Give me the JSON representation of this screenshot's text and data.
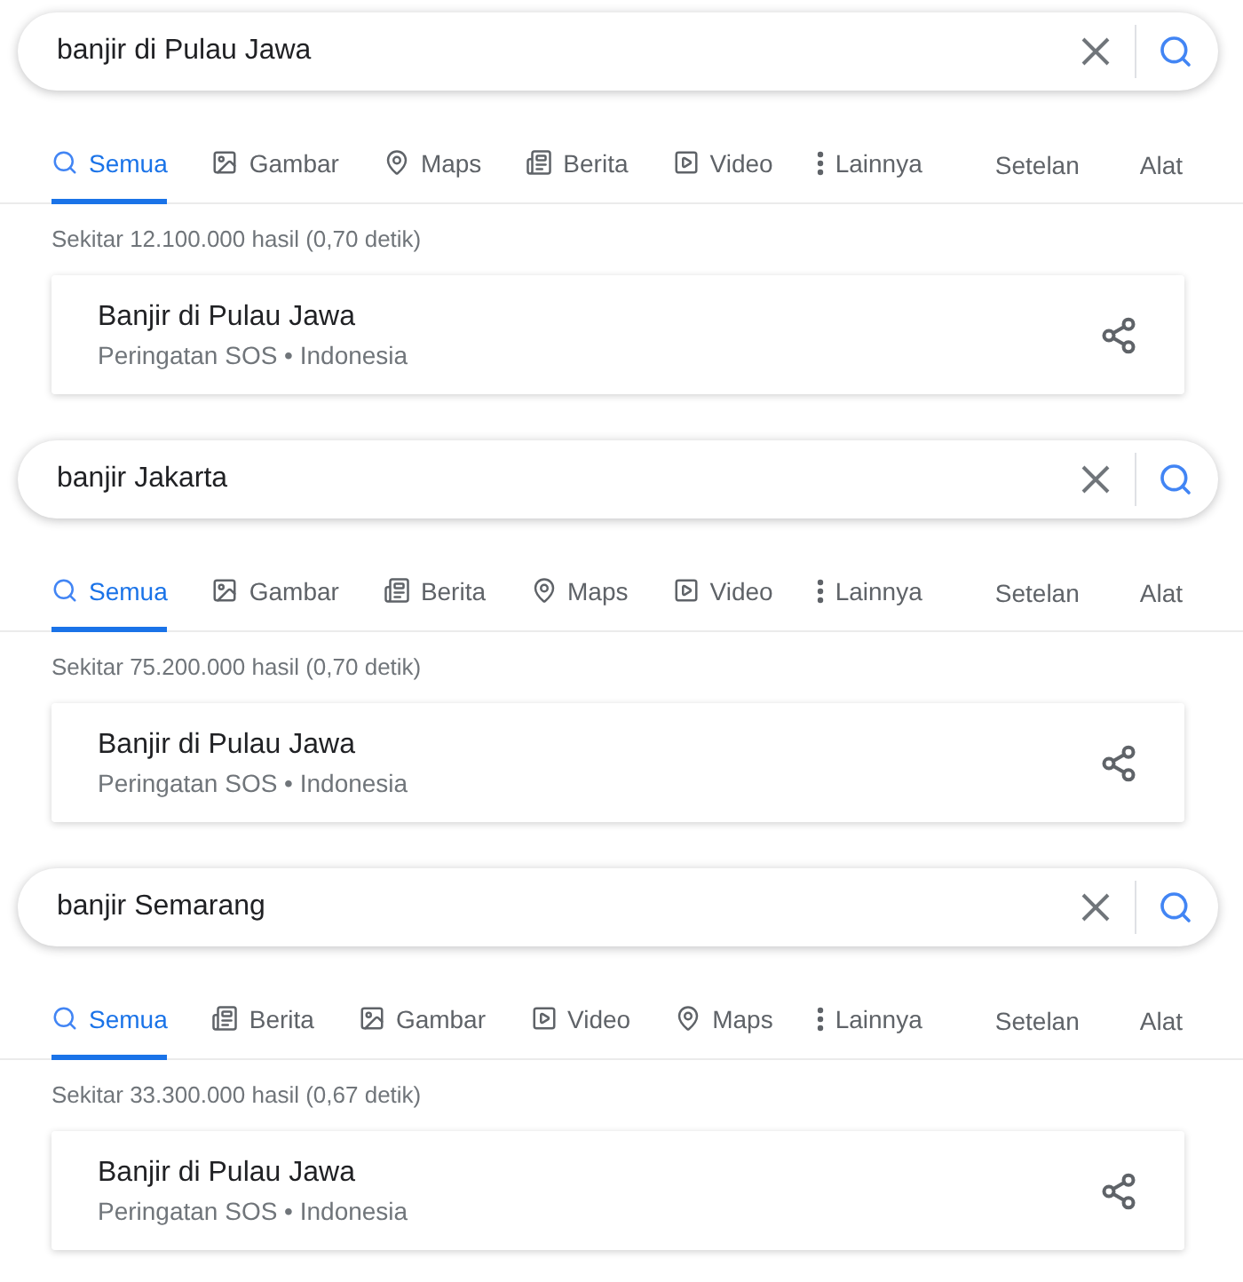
{
  "searches": [
    {
      "query": "banjir di Pulau Jawa",
      "tabs": [
        {
          "kind": "all",
          "label": "Semua",
          "selected": true
        },
        {
          "kind": "images",
          "label": "Gambar",
          "selected": false
        },
        {
          "kind": "maps",
          "label": "Maps",
          "selected": false
        },
        {
          "kind": "news",
          "label": "Berita",
          "selected": false
        },
        {
          "kind": "video",
          "label": "Video",
          "selected": false
        },
        {
          "kind": "more",
          "label": "Lainnya",
          "selected": false
        }
      ],
      "tools": [
        "Setelan",
        "Alat"
      ],
      "stats": "Sekitar 12.100.000 hasil (0,70 detik)",
      "result": {
        "title": "Banjir di Pulau Jawa",
        "subtitle": "Peringatan SOS • Indonesia"
      }
    },
    {
      "query": "banjir Jakarta",
      "tabs": [
        {
          "kind": "all",
          "label": "Semua",
          "selected": true
        },
        {
          "kind": "images",
          "label": "Gambar",
          "selected": false
        },
        {
          "kind": "news",
          "label": "Berita",
          "selected": false
        },
        {
          "kind": "maps",
          "label": "Maps",
          "selected": false
        },
        {
          "kind": "video",
          "label": "Video",
          "selected": false
        },
        {
          "kind": "more",
          "label": "Lainnya",
          "selected": false
        }
      ],
      "tools": [
        "Setelan",
        "Alat"
      ],
      "stats": "Sekitar 75.200.000 hasil (0,70 detik)",
      "result": {
        "title": "Banjir di Pulau Jawa",
        "subtitle": "Peringatan SOS • Indonesia"
      }
    },
    {
      "query": "banjir Semarang",
      "tabs": [
        {
          "kind": "all",
          "label": "Semua",
          "selected": true
        },
        {
          "kind": "news",
          "label": "Berita",
          "selected": false
        },
        {
          "kind": "images",
          "label": "Gambar",
          "selected": false
        },
        {
          "kind": "video",
          "label": "Video",
          "selected": false
        },
        {
          "kind": "maps",
          "label": "Maps",
          "selected": false
        },
        {
          "kind": "more",
          "label": "Lainnya",
          "selected": false
        }
      ],
      "tools": [
        "Setelan",
        "Alat"
      ],
      "stats": "Sekitar 33.300.000 hasil (0,67 detik)",
      "result": {
        "title": "Banjir di Pulau Jawa",
        "subtitle": "Peringatan SOS • Indonesia"
      }
    }
  ]
}
